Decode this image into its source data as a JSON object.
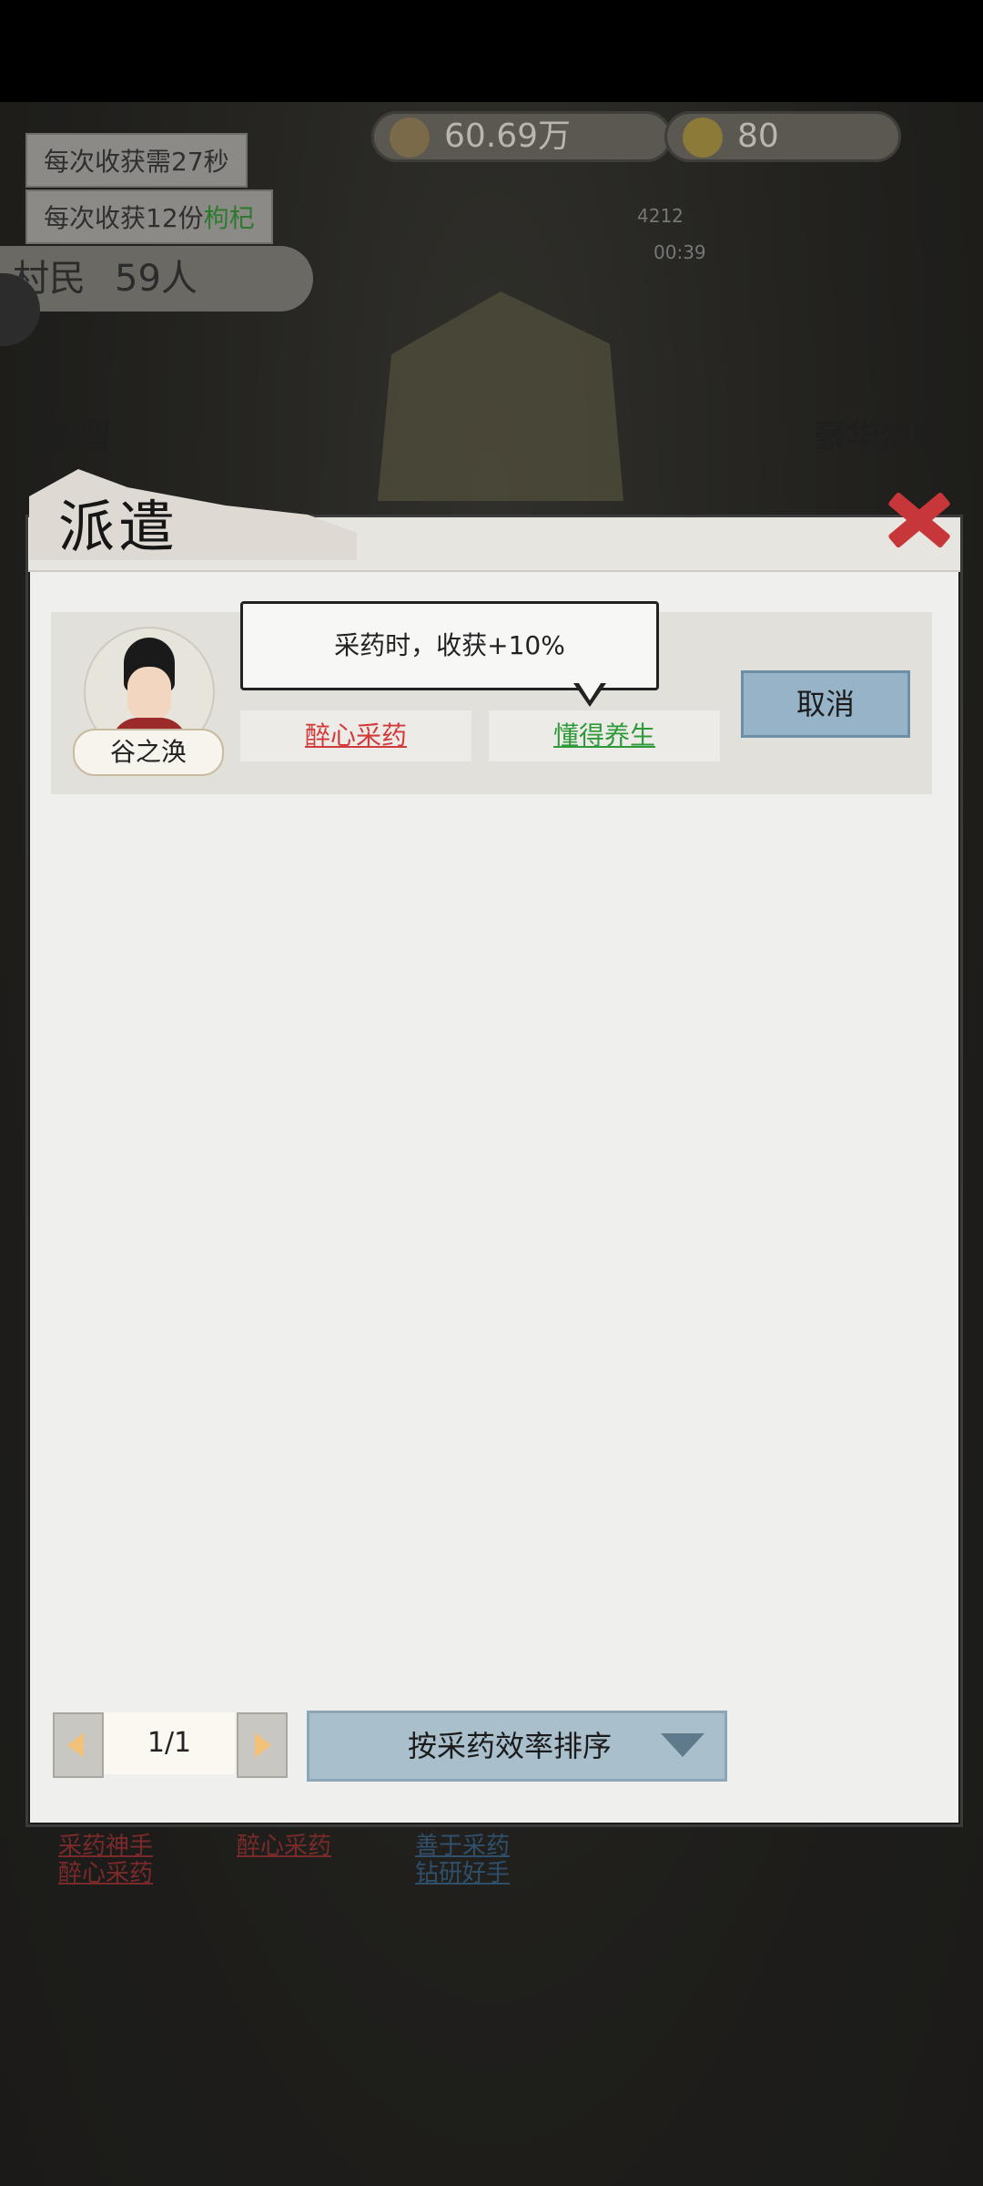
{
  "background": {
    "hud": {
      "coins": "60.69万",
      "gold": "80"
    },
    "info_lines": [
      {
        "text": "每次收获需27秒"
      },
      {
        "text_prefix": "每次收获12份",
        "text_highlight": "枸杞"
      }
    ],
    "villagers_label": "村民",
    "villagers_count": "59人",
    "hut_timer": "4212",
    "hut_countdown": "00:39",
    "left_action": "收留",
    "right_action": "豪华资助",
    "skills_col1": [
      "采药神手",
      "醉心采药"
    ],
    "skills_col2": [
      "醉心采药"
    ],
    "skills_col3": [
      "善于采药",
      "钻研好手"
    ]
  },
  "modal": {
    "title": "派遣",
    "character": {
      "name": "谷之涣",
      "traits": [
        {
          "label": "醉心采药",
          "color": "#d23b3b"
        },
        {
          "label": "懂得养生",
          "color": "#2f9a39"
        }
      ]
    },
    "tooltip": "采药时，收获+10%",
    "cancel_label": "取消",
    "pagination": {
      "page_text": "1/1"
    },
    "sort_label": "按采药效率排序"
  },
  "colors": {
    "accent_blue": "#97b3c8",
    "trait_red": "#d23b3b",
    "trait_green": "#2f9a39",
    "close_red": "#c7373a"
  },
  "icons": [
    "close-icon",
    "prev-page-icon",
    "next-page-icon",
    "chevron-down-icon"
  ]
}
